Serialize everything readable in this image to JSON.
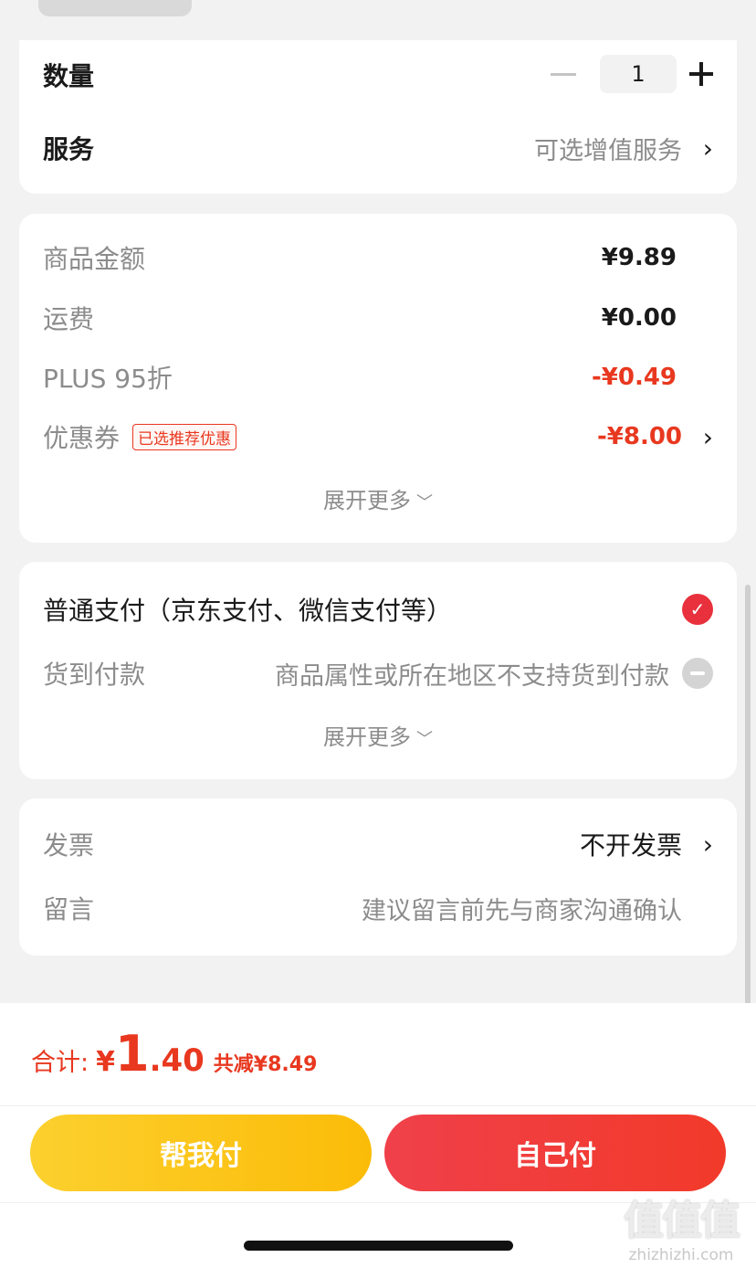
{
  "order": {
    "quantity_label": "数量",
    "quantity_value": "1",
    "service_label": "服务",
    "service_value": "可选增值服务"
  },
  "price": {
    "goods_label": "商品金额",
    "goods_value": "¥9.89",
    "shipping_label": "运费",
    "shipping_value": "¥0.00",
    "plus_label": "PLUS 95折",
    "plus_value": "-¥0.49",
    "coupon_label": "优惠券",
    "coupon_tag": "已选推荐优惠",
    "coupon_value": "-¥8.00",
    "expand_label": "展开更多"
  },
  "payment": {
    "normal_label": "普通支付（京东支付、微信支付等）",
    "cod_label": "货到付款",
    "cod_note": "商品属性或所在地区不支持货到付款",
    "expand_label": "展开更多"
  },
  "invoice": {
    "invoice_label": "发票",
    "invoice_value": "不开发票",
    "message_label": "留言",
    "message_placeholder": "建议留言前先与商家沟通确认"
  },
  "summary": {
    "total_label": "合计:",
    "currency": "¥",
    "total_int": "1",
    "total_dec": ".40",
    "saved_text": "共减¥8.49"
  },
  "actions": {
    "help_pay": "帮我付",
    "self_pay": "自己付"
  },
  "watermark": {
    "logo": "值值值",
    "url": "zhizhizhi.com"
  },
  "colors": {
    "accent_red": "#e8381f",
    "help_button": "#fbbc08",
    "self_button": "#f0404a"
  }
}
